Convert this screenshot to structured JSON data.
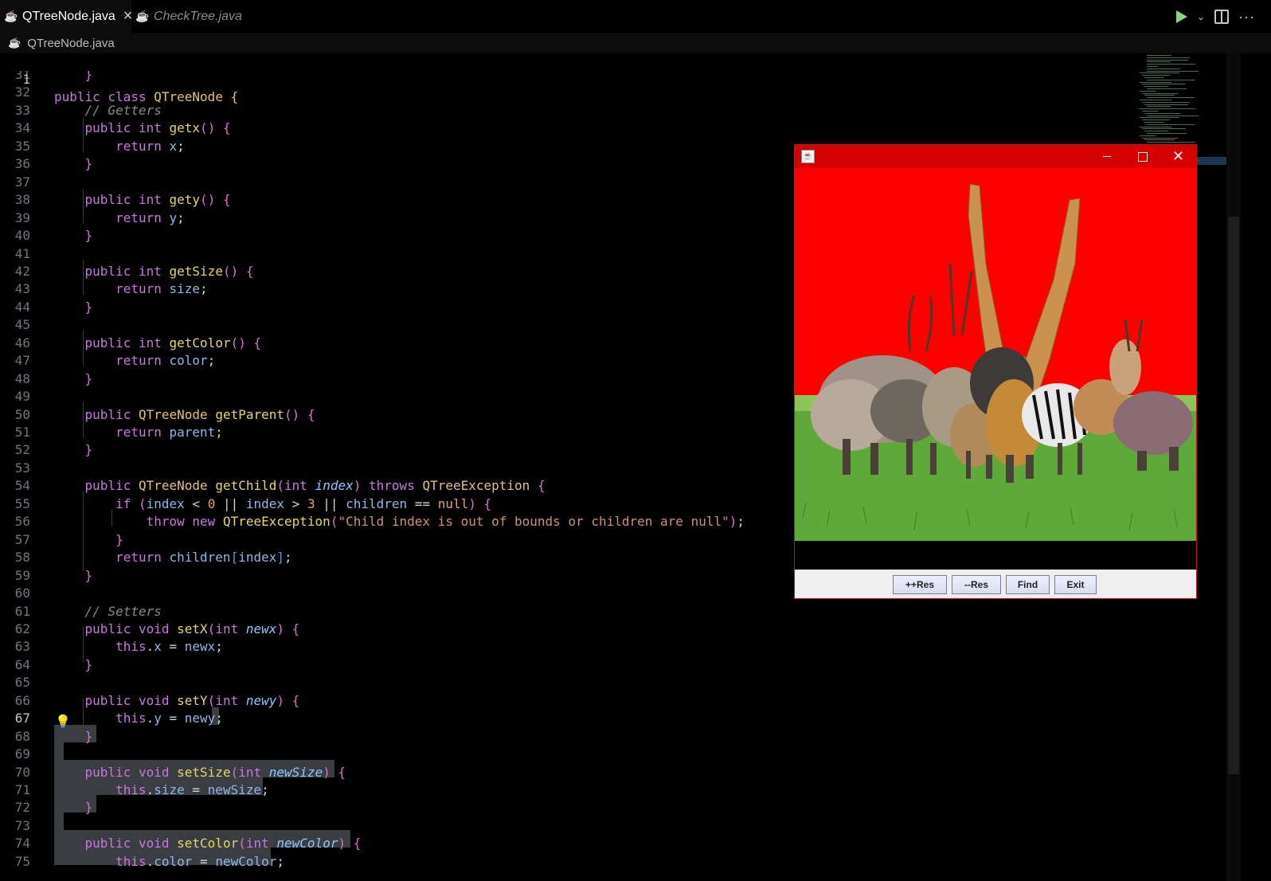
{
  "tabs": [
    {
      "label": "QTreeNode.java",
      "active": true,
      "icon": "java-file-icon"
    },
    {
      "label": "CheckTree.java",
      "active": false,
      "icon": "java-file-icon"
    }
  ],
  "breadcrumb": {
    "file": "QTreeNode.java"
  },
  "sticky_line": {
    "num": "1",
    "text": "public class QTreeNode {"
  },
  "lines": [
    {
      "num": "31",
      "text": "    }"
    },
    {
      "num": "32",
      "text": ""
    },
    {
      "num": "33",
      "text": "    // Getters"
    },
    {
      "num": "34",
      "text": "    public int getx() {"
    },
    {
      "num": "35",
      "text": "        return x;"
    },
    {
      "num": "36",
      "text": "    }"
    },
    {
      "num": "37",
      "text": ""
    },
    {
      "num": "38",
      "text": "    public int gety() {"
    },
    {
      "num": "39",
      "text": "        return y;"
    },
    {
      "num": "40",
      "text": "    }"
    },
    {
      "num": "41",
      "text": ""
    },
    {
      "num": "42",
      "text": "    public int getSize() {"
    },
    {
      "num": "43",
      "text": "        return size;"
    },
    {
      "num": "44",
      "text": "    }"
    },
    {
      "num": "45",
      "text": ""
    },
    {
      "num": "46",
      "text": "    public int getColor() {"
    },
    {
      "num": "47",
      "text": "        return color;"
    },
    {
      "num": "48",
      "text": "    }"
    },
    {
      "num": "49",
      "text": ""
    },
    {
      "num": "50",
      "text": "    public QTreeNode getParent() {"
    },
    {
      "num": "51",
      "text": "        return parent;"
    },
    {
      "num": "52",
      "text": "    }"
    },
    {
      "num": "53",
      "text": ""
    },
    {
      "num": "54",
      "text": "    public QTreeNode getChild(int index) throws QTreeException {"
    },
    {
      "num": "55",
      "text": "        if (index < 0 || index > 3 || children == null) {"
    },
    {
      "num": "56",
      "text": "            throw new QTreeException(\"Child index is out of bounds or children are null\");"
    },
    {
      "num": "57",
      "text": "        }"
    },
    {
      "num": "58",
      "text": "        return children[index];"
    },
    {
      "num": "59",
      "text": "    }"
    },
    {
      "num": "60",
      "text": ""
    },
    {
      "num": "61",
      "text": "    // Setters"
    },
    {
      "num": "62",
      "text": "    public void setX(int newx) {"
    },
    {
      "num": "63",
      "text": "        this.x = newx;"
    },
    {
      "num": "64",
      "text": "    }"
    },
    {
      "num": "65",
      "text": ""
    },
    {
      "num": "66",
      "text": "    public void setY(int newy) {"
    },
    {
      "num": "67",
      "text": "        this.y = newy;"
    },
    {
      "num": "68",
      "text": "    }"
    },
    {
      "num": "69",
      "text": ""
    },
    {
      "num": "70",
      "text": "    public void setSize(int newSize) {"
    },
    {
      "num": "71",
      "text": "        this.size = newSize;"
    },
    {
      "num": "72",
      "text": "    }"
    },
    {
      "num": "73",
      "text": ""
    },
    {
      "num": "74",
      "text": "    public void setColor(int newColor) {"
    },
    {
      "num": "75",
      "text": "        this.color = newColor;"
    }
  ],
  "current_line": "67",
  "java_window": {
    "buttons": [
      "++Res",
      "--Res",
      "Find",
      "Exit"
    ]
  },
  "colors": {
    "title_bar": "#d50000",
    "canvas_bg": "#ff0000",
    "grass": "#5fa83a"
  }
}
